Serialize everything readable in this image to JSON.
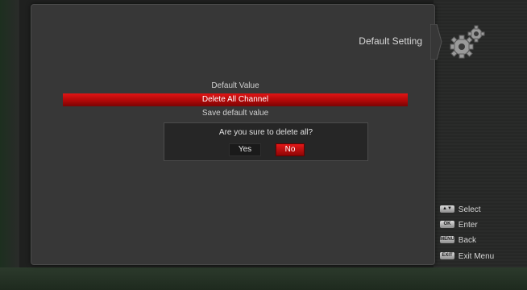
{
  "header": {
    "title": "Default Setting",
    "icon": "gears-icon"
  },
  "menu": {
    "items": [
      {
        "label": "Default Value"
      },
      {
        "label": "Delete All Channel"
      },
      {
        "label": "Save default value"
      }
    ],
    "selected_index": 1
  },
  "dialog": {
    "message": "Are you sure to delete all?",
    "yes_label": "Yes",
    "no_label": "No",
    "focused": "No"
  },
  "help": [
    {
      "key": "▲▼",
      "icon": "up-down-key-icon",
      "label": "Select"
    },
    {
      "key": "OK",
      "icon": "ok-key-icon",
      "label": "Enter"
    },
    {
      "key": "MENU",
      "icon": "menu-key-icon",
      "label": "Back"
    },
    {
      "key": "EXIT",
      "icon": "exit-key-icon",
      "label": "Exit Menu"
    }
  ],
  "colors": {
    "accent": "#c80a0a",
    "panel": "#373737",
    "text": "#d0d0d0"
  }
}
